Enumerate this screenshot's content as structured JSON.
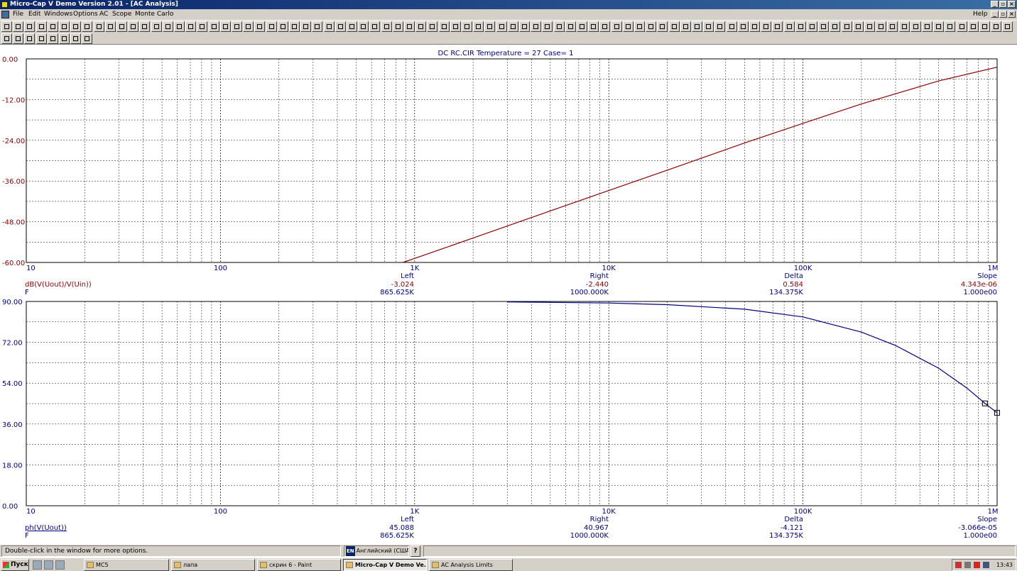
{
  "window": {
    "title": "Micro-Cap V Demo Version 2.01 - [AC Analysis]"
  },
  "menu": {
    "items": [
      "File",
      "Edit",
      "Windows",
      "Options",
      "AC",
      "Scope",
      "Monte Carlo"
    ],
    "help": "Help"
  },
  "plot": {
    "title": "DC  RC.CIR Temperature = 27 Case= 1",
    "x_ticks": [
      "10",
      "100",
      "1K",
      "10K",
      "100K",
      "1M"
    ],
    "upper": {
      "y_ticks": [
        "0.00",
        "-12.00",
        "-24.00",
        "-36.00",
        "-48.00",
        "-60.00"
      ],
      "trace_color": "#8b0000",
      "expr": "dB(V(Uout)/V(Uin))",
      "xvar": "F",
      "cursor_headers": [
        "Left",
        "Right",
        "Delta",
        "Slope"
      ],
      "cursor_values": [
        "-3.024",
        "-2.440",
        "0.584",
        "4.343e-06"
      ],
      "cursor_freqs": [
        "865.625K",
        "1000.000K",
        "134.375K",
        "1.000e00"
      ]
    },
    "lower": {
      "y_ticks": [
        "90.00",
        "72.00",
        "54.00",
        "36.00",
        "18.00",
        "0.00"
      ],
      "trace_color": "#000080",
      "expr": "ph(V(Uout))",
      "xvar": "F",
      "cursor_headers": [
        "Left",
        "Right",
        "Delta",
        "Slope"
      ],
      "cursor_values": [
        "45.088",
        "40.967",
        "-4.121",
        "-3.066e-05"
      ],
      "cursor_freqs": [
        "865.625K",
        "1000.000K",
        "134.375K",
        "1.000e00"
      ]
    }
  },
  "chart_data": [
    {
      "type": "line",
      "title": "DC  RC.CIR Temperature = 27 Case= 1",
      "xscale": "log",
      "xlim": [
        10,
        1000000
      ],
      "ylim": [
        -60,
        0
      ],
      "grid": true,
      "ylabel": "dB(V(Uout)/V(Uin))",
      "xlabel": "F",
      "series": [
        {
          "name": "dB(V(Uout)/V(Uin))",
          "x": [
            870,
            1000,
            2000,
            5000,
            10000,
            20000,
            50000,
            100000,
            200000,
            500000,
            1000000
          ],
          "y": [
            -60,
            -58.8,
            -52.8,
            -44.8,
            -38.8,
            -32.8,
            -24.8,
            -19.0,
            -13.3,
            -6.5,
            -2.44
          ]
        }
      ]
    },
    {
      "type": "line",
      "title": "DC  RC.CIR Temperature = 27 Case= 1",
      "xscale": "log",
      "xlim": [
        10,
        1000000
      ],
      "ylim": [
        0,
        90
      ],
      "grid": true,
      "ylabel": "ph(V(Uout))",
      "xlabel": "F",
      "series": [
        {
          "name": "ph(V(Uout))",
          "x": [
            3000,
            5000,
            10000,
            20000,
            50000,
            100000,
            200000,
            300000,
            500000,
            700000,
            865625,
            1000000
          ],
          "y": [
            89.8,
            89.6,
            89.3,
            88.6,
            86.6,
            83.2,
            76.5,
            70.6,
            60.6,
            51.8,
            45.088,
            40.967
          ]
        }
      ]
    }
  ],
  "statusbar": {
    "message": "Double-click in the window for more options.",
    "lang_code": "EN",
    "lang": "Английский (США)",
    "help": "?"
  },
  "taskbar": {
    "start": "Пуск",
    "tasks": [
      "MC5",
      "лапа",
      "скрин 6 - Paint",
      "Micro-Cap V Demo Ve...",
      "AC Analysis Limits"
    ],
    "clock": "13:43"
  }
}
